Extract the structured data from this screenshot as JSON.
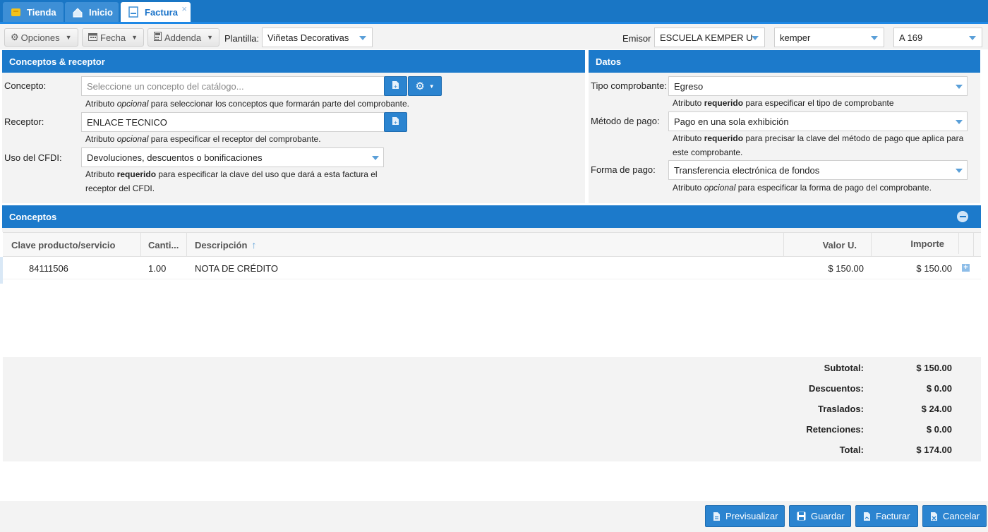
{
  "tabs": [
    {
      "label": "Tienda"
    },
    {
      "label": "Inicio"
    },
    {
      "label": "Factura",
      "close": "×"
    }
  ],
  "toolbar": {
    "opciones": "Opciones",
    "fecha": "Fecha",
    "addenda": "Addenda",
    "plantilla_label": "Plantilla:",
    "plantilla_value": "Viñetas Decorativas",
    "emisor_label": "Emisor",
    "emisor_value": "ESCUELA KEMPER U",
    "user_value": "kemper",
    "serie_value": "A 169"
  },
  "conceptos_receptor": {
    "title": "Conceptos & receptor",
    "concepto_label": "Concepto:",
    "concepto_placeholder": "Seleccione un concepto del catálogo...",
    "concepto_help_pre": "Atributo ",
    "concepto_help_em": "opcional",
    "concepto_help_post": " para seleccionar los conceptos que formarán parte del comprobante.",
    "receptor_label": "Receptor:",
    "receptor_value": "ENLACE TECNICO",
    "receptor_help_pre": "Atributo ",
    "receptor_help_em": "opcional",
    "receptor_help_post": " para especificar el receptor del comprobante.",
    "uso_label": "Uso del CFDI:",
    "uso_value": "Devoluciones, descuentos o bonificaciones",
    "uso_help_pre": "Atributo ",
    "uso_help_b": "requerido",
    "uso_help_post": " para especificar la clave del uso que dará a esta factura el",
    "uso_help_line2": "receptor del CFDI."
  },
  "datos": {
    "title": "Datos",
    "tipo_label": "Tipo comprobante:",
    "tipo_value": "Egreso",
    "tipo_help_pre": "Atributo ",
    "tipo_help_b": "requerido",
    "tipo_help_post": " para especificar el tipo de comprobante",
    "metodo_label": "Método de pago:",
    "metodo_value": "Pago en una sola exhibición",
    "metodo_help_pre": "Atributo ",
    "metodo_help_b": "requerido",
    "metodo_help_post": " para precisar la clave del método de pago que aplica para",
    "metodo_help_line2": "este comprobante.",
    "forma_label": "Forma de pago:",
    "forma_value": "Transferencia electrónica de fondos",
    "forma_help_pre": "Atributo ",
    "forma_help_em": "opcional",
    "forma_help_post": " para especificar la forma de pago del comprobante."
  },
  "conceptos": {
    "title": "Conceptos",
    "columns": {
      "clave": "Clave producto/servicio",
      "cantidad": "Canti...",
      "descripcion": "Descripción",
      "valor": "Valor U.",
      "importe": "Importe"
    },
    "rows": [
      {
        "clave": "84111506",
        "cantidad": "1.00",
        "descripcion": "NOTA DE CRÉDITO",
        "valor": "$ 150.00",
        "importe": "$ 150.00"
      }
    ]
  },
  "totals": {
    "subtotal_label": "Subtotal:",
    "subtotal": "$ 150.00",
    "descuentos_label": "Descuentos:",
    "descuentos": "$ 0.00",
    "traslados_label": "Traslados:",
    "traslados": "$ 24.00",
    "retenciones_label": "Retenciones:",
    "retenciones": "$ 0.00",
    "total_label": "Total:",
    "total": "$ 174.00"
  },
  "footer": {
    "previsualizar": "Previsualizar",
    "guardar": "Guardar",
    "facturar": "Facturar",
    "cancelar": "Cancelar"
  },
  "colors": {
    "header": "#1c7acb",
    "button": "#2b84d0",
    "panel": "#f3f3f3"
  }
}
